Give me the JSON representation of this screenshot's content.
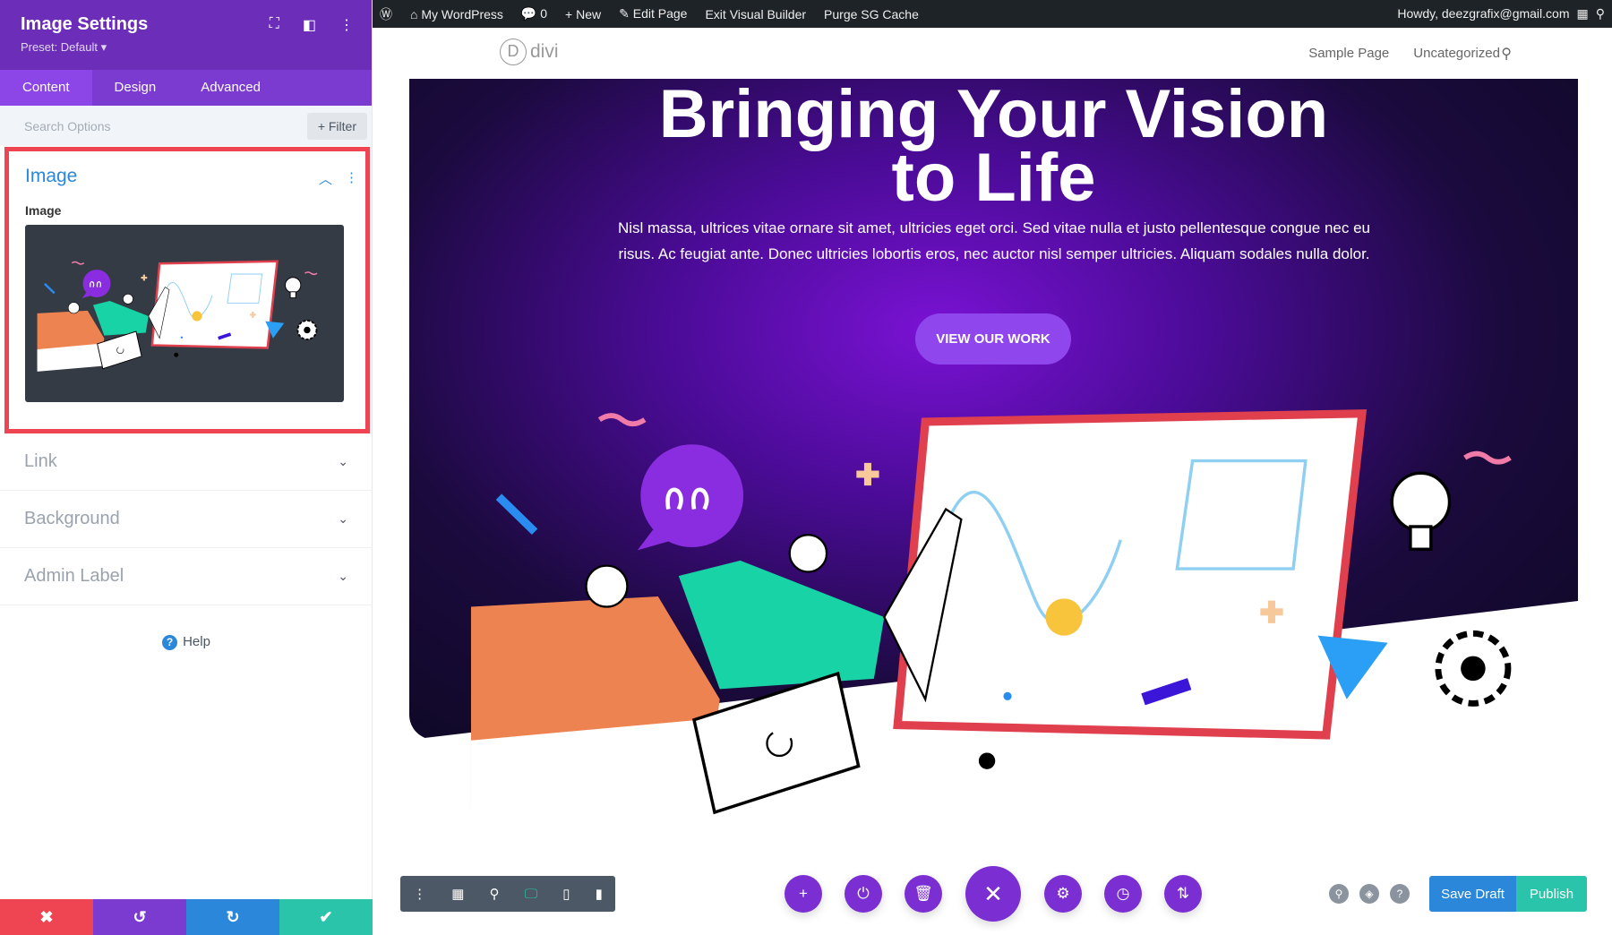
{
  "sidebar": {
    "title": "Image Settings",
    "preset": "Preset: Default ▾",
    "tabs": [
      "Content",
      "Design",
      "Advanced"
    ],
    "search_placeholder": "Search Options",
    "filter_label": "+ Filter",
    "image_section": {
      "title": "Image",
      "field_label": "Image"
    },
    "sections": [
      "Link",
      "Background",
      "Admin Label"
    ],
    "help_label": "Help",
    "footer": {
      "cancel": "✖",
      "undo": "↺",
      "redo": "↻",
      "save": "✔"
    }
  },
  "adminbar": {
    "site": "My WordPress",
    "comments": "0",
    "new": "New",
    "edit": "Edit Page",
    "exit": "Exit Visual Builder",
    "purge": "Purge SG Cache",
    "howdy": "Howdy, deezgrafix@gmail.com"
  },
  "nav": {
    "logo": "divi",
    "items": [
      "Sample Page",
      "Uncategorized"
    ]
  },
  "hero": {
    "heading_line1": "Bringing Your Vision",
    "heading_line2": "to Life",
    "paragraph": "Nisl massa, ultrices vitae ornare sit amet, ultricies eget orci. Sed vitae nulla et justo pellentesque congue nec eu risus. Ac feugiat ante. Donec ultricies lobortis eros, nec auctor nisl semper ultricies. Aliquam sodales nulla dolor.",
    "button": "VIEW OUR WORK"
  },
  "toolbar": {
    "save_draft": "Save Draft",
    "publish": "Publish"
  },
  "colors": {
    "purple": "#6c2eb9",
    "blue": "#2b87da",
    "green": "#29c4a9",
    "red": "#ef4452"
  }
}
